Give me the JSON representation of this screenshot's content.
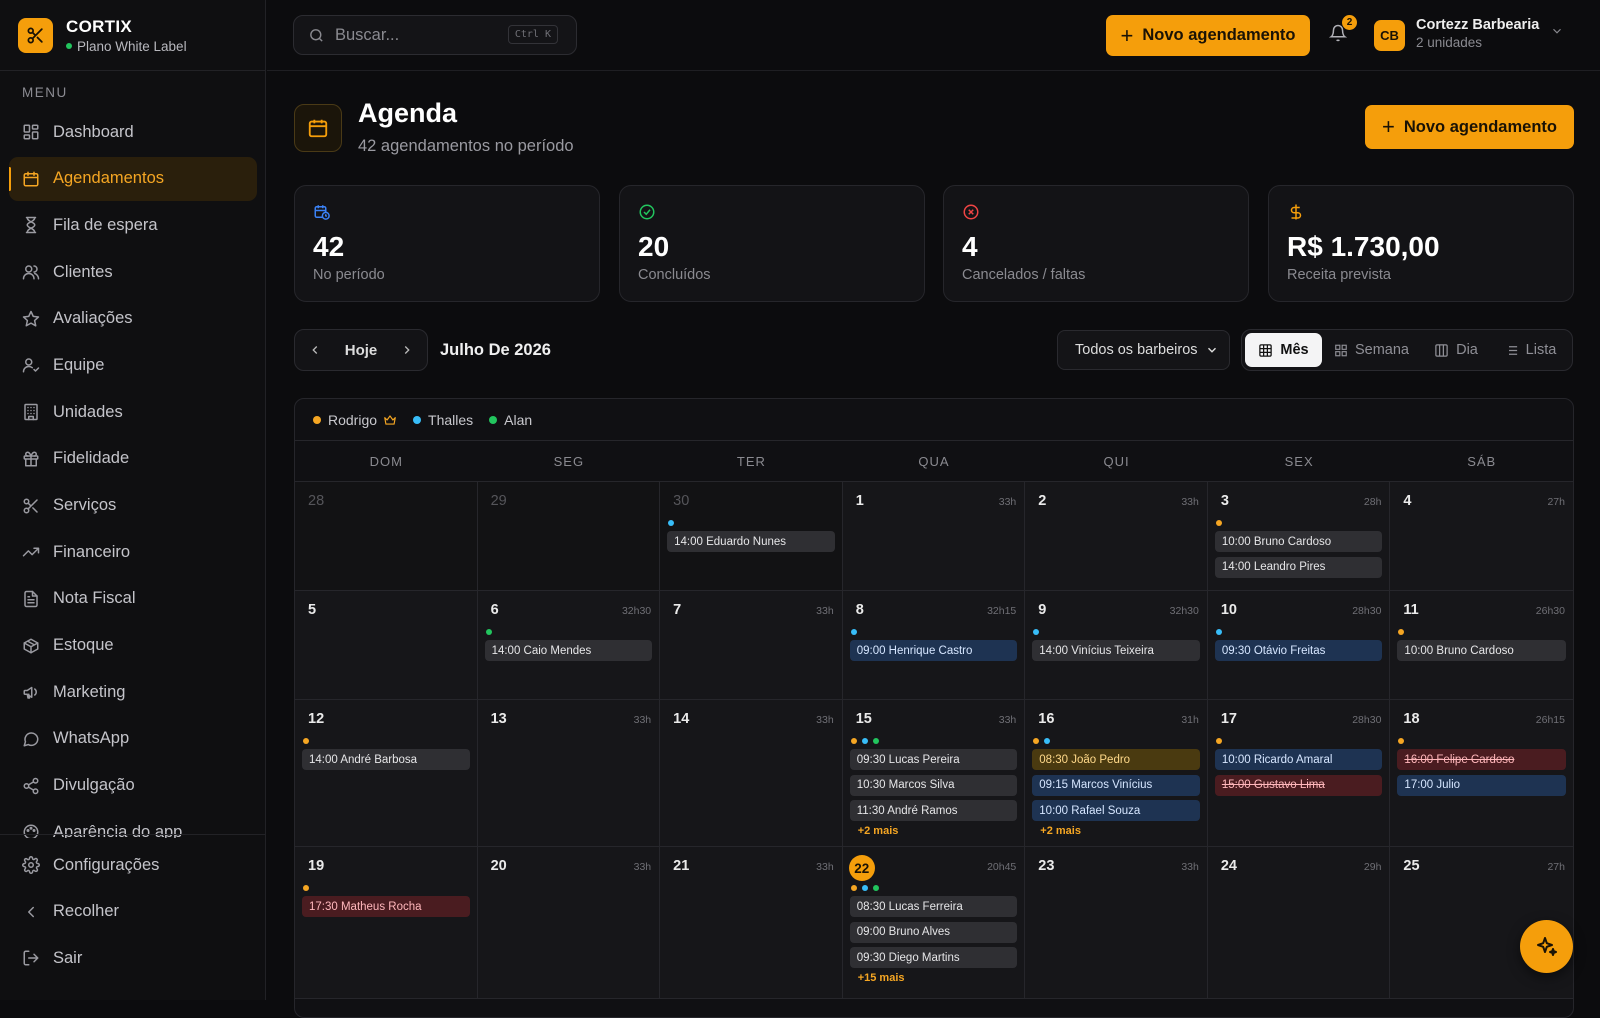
{
  "brand": {
    "name": "CORTIX",
    "plan": "Plano White Label"
  },
  "sidebar": {
    "menu_label": "MENU",
    "items": [
      {
        "label": "Dashboard",
        "icon": "dashboard-icon",
        "active": false
      },
      {
        "label": "Agendamentos",
        "icon": "calendar-icon",
        "active": true
      },
      {
        "label": "Fila de espera",
        "icon": "hourglass-icon",
        "active": false
      },
      {
        "label": "Clientes",
        "icon": "users-icon",
        "active": false
      },
      {
        "label": "Avaliações",
        "icon": "star-icon",
        "active": false
      },
      {
        "label": "Equipe",
        "icon": "user-check-icon",
        "active": false
      },
      {
        "label": "Unidades",
        "icon": "building-icon",
        "active": false
      },
      {
        "label": "Fidelidade",
        "icon": "gift-icon",
        "active": false
      },
      {
        "label": "Serviços",
        "icon": "scissors-icon",
        "active": false
      },
      {
        "label": "Financeiro",
        "icon": "trending-up-icon",
        "active": false
      },
      {
        "label": "Nota Fiscal",
        "icon": "file-text-icon",
        "active": false
      },
      {
        "label": "Estoque",
        "icon": "package-icon",
        "active": false
      },
      {
        "label": "Marketing",
        "icon": "megaphone-icon",
        "active": false
      },
      {
        "label": "WhatsApp",
        "icon": "chat-icon",
        "active": false
      },
      {
        "label": "Divulgação",
        "icon": "share-icon",
        "active": false
      },
      {
        "label": "Aparência do app",
        "icon": "palette-icon",
        "active": false
      }
    ],
    "bottom": [
      {
        "label": "Configurações",
        "icon": "gear-icon"
      },
      {
        "label": "Recolher",
        "icon": "chevron-left-icon"
      },
      {
        "label": "Sair",
        "icon": "logout-icon"
      }
    ]
  },
  "topbar": {
    "search_placeholder": "Buscar...",
    "shortcut": "Ctrl K",
    "new_button": "Novo agendamento",
    "notification_count": "2",
    "user_initials": "CB",
    "user_name": "Cortezz Barbearia",
    "user_units": "2 unidades"
  },
  "page": {
    "title": "Agenda",
    "subtitle": "42 agendamentos no período",
    "new_button": "Novo agendamento"
  },
  "stats": [
    {
      "value": "42",
      "label": "No período",
      "icon": "calendar-clock-icon",
      "color": "#3b82f6"
    },
    {
      "value": "20",
      "label": "Concluídos",
      "icon": "check-circle-icon",
      "color": "#22c55e"
    },
    {
      "value": "4",
      "label": "Cancelados / faltas",
      "icon": "x-circle-icon",
      "color": "#ef4444"
    },
    {
      "value": "R$ 1.730,00",
      "label": "Receita prevista",
      "icon": "dollar-icon",
      "color": "#f59e0b"
    }
  ],
  "controls": {
    "today": "Hoje",
    "month_title": "Julho De 2026",
    "barber_filter": "Todos os barbeiros",
    "views": [
      "Mês",
      "Semana",
      "Dia",
      "Lista"
    ],
    "active_view": "Mês"
  },
  "legend": [
    {
      "name": "Rodrigo",
      "color": "#f5a623",
      "crown": true
    },
    {
      "name": "Thalles",
      "color": "#38bdf8",
      "crown": false
    },
    {
      "name": "Alan",
      "color": "#22c55e",
      "crown": false
    }
  ],
  "weekdays": [
    "DOM",
    "SEG",
    "TER",
    "QUA",
    "QUI",
    "SEX",
    "SÁB"
  ],
  "colors": {
    "accent": "#f59e0b",
    "rodrigo": "#f5a623",
    "thalles": "#38bdf8",
    "alan": "#22c55e"
  },
  "weeks": [
    [
      {
        "day": "28",
        "out": true,
        "hours": "",
        "dots": [],
        "events": []
      },
      {
        "day": "29",
        "out": true,
        "hours": "",
        "dots": [],
        "events": []
      },
      {
        "day": "30",
        "out": true,
        "hours": "",
        "dots": [
          "thalles"
        ],
        "events": [
          {
            "text": "14:00 Eduardo Nunes",
            "style": "gray"
          }
        ]
      },
      {
        "day": "1",
        "out": false,
        "hours": "33h",
        "dots": [],
        "events": []
      },
      {
        "day": "2",
        "out": false,
        "hours": "33h",
        "dots": [],
        "events": []
      },
      {
        "day": "3",
        "out": false,
        "hours": "28h",
        "dots": [
          "rodrigo"
        ],
        "events": [
          {
            "text": "10:00 Bruno Cardoso",
            "style": "gray"
          },
          {
            "text": "14:00 Leandro Pires",
            "style": "gray"
          }
        ]
      },
      {
        "day": "4",
        "out": false,
        "hours": "27h",
        "dots": [],
        "events": []
      }
    ],
    [
      {
        "day": "5",
        "out": false,
        "hours": "",
        "dots": [],
        "events": []
      },
      {
        "day": "6",
        "out": false,
        "hours": "32h30",
        "dots": [
          "alan"
        ],
        "events": [
          {
            "text": "14:00 Caio Mendes",
            "style": "gray"
          }
        ]
      },
      {
        "day": "7",
        "out": false,
        "hours": "33h",
        "dots": [],
        "events": []
      },
      {
        "day": "8",
        "out": false,
        "hours": "32h15",
        "dots": [
          "thalles"
        ],
        "events": [
          {
            "text": "09:00 Henrique Castro",
            "style": "blue"
          }
        ]
      },
      {
        "day": "9",
        "out": false,
        "hours": "32h30",
        "dots": [
          "thalles"
        ],
        "events": [
          {
            "text": "14:00 Vinícius Teixeira",
            "style": "gray"
          }
        ]
      },
      {
        "day": "10",
        "out": false,
        "hours": "28h30",
        "dots": [
          "thalles"
        ],
        "events": [
          {
            "text": "09:30 Otávio Freitas",
            "style": "blue"
          }
        ]
      },
      {
        "day": "11",
        "out": false,
        "hours": "26h30",
        "dots": [
          "rodrigo"
        ],
        "events": [
          {
            "text": "10:00 Bruno Cardoso",
            "style": "gray"
          }
        ]
      }
    ],
    [
      {
        "day": "12",
        "out": false,
        "hours": "",
        "dots": [
          "rodrigo"
        ],
        "events": [
          {
            "text": "14:00 André Barbosa",
            "style": "gray"
          }
        ]
      },
      {
        "day": "13",
        "out": false,
        "hours": "33h",
        "dots": [],
        "events": []
      },
      {
        "day": "14",
        "out": false,
        "hours": "33h",
        "dots": [],
        "events": []
      },
      {
        "day": "15",
        "out": false,
        "hours": "33h",
        "dots": [
          "rodrigo",
          "thalles",
          "alan"
        ],
        "events": [
          {
            "text": "09:30 Lucas Pereira",
            "style": "gray"
          },
          {
            "text": "10:30 Marcos Silva",
            "style": "gray"
          },
          {
            "text": "11:30 André Ramos",
            "style": "gray"
          }
        ],
        "more": "+2 mais"
      },
      {
        "day": "16",
        "out": false,
        "hours": "31h",
        "dots": [
          "rodrigo",
          "thalles"
        ],
        "events": [
          {
            "text": "08:30 João Pedro",
            "style": "gold"
          },
          {
            "text": "09:15 Marcos Vinícius",
            "style": "blue"
          },
          {
            "text": "10:00 Rafael Souza",
            "style": "blue"
          }
        ],
        "more": "+2 mais"
      },
      {
        "day": "17",
        "out": false,
        "hours": "28h30",
        "dots": [
          "rodrigo"
        ],
        "events": [
          {
            "text": "10:00 Ricardo Amaral",
            "style": "blue"
          },
          {
            "text": "15:00 Gustavo Lima",
            "style": "red strike"
          }
        ]
      },
      {
        "day": "18",
        "out": false,
        "hours": "26h15",
        "dots": [
          "rodrigo"
        ],
        "events": [
          {
            "text": "16:00 Felipe Cardoso",
            "style": "red strike"
          },
          {
            "text": "17:00 Julio",
            "style": "blue"
          }
        ]
      }
    ],
    [
      {
        "day": "19",
        "out": false,
        "hours": "",
        "dots": [
          "rodrigo"
        ],
        "events": [
          {
            "text": "17:30 Matheus Rocha",
            "style": "red"
          }
        ]
      },
      {
        "day": "20",
        "out": false,
        "hours": "33h",
        "dots": [],
        "events": []
      },
      {
        "day": "21",
        "out": false,
        "hours": "33h",
        "dots": [],
        "events": []
      },
      {
        "day": "22",
        "out": false,
        "today": true,
        "hours": "20h45",
        "dots": [
          "rodrigo",
          "thalles",
          "alan"
        ],
        "events": [
          {
            "text": "08:30 Lucas Ferreira",
            "style": "gray"
          },
          {
            "text": "09:00 Bruno Alves",
            "style": "gray"
          },
          {
            "text": "09:30 Diego Martins",
            "style": "gray"
          }
        ],
        "more": "+15 mais"
      },
      {
        "day": "23",
        "out": false,
        "hours": "33h",
        "dots": [],
        "events": []
      },
      {
        "day": "24",
        "out": false,
        "hours": "29h",
        "dots": [],
        "events": []
      },
      {
        "day": "25",
        "out": false,
        "hours": "27h",
        "dots": [],
        "events": []
      }
    ]
  ]
}
